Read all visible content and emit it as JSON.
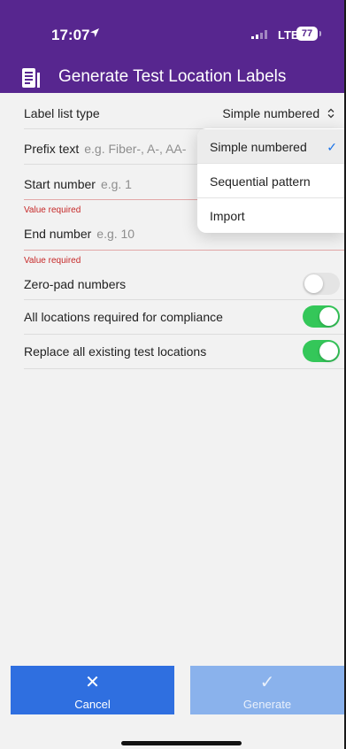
{
  "status_bar": {
    "time": "17:07",
    "network": "LTE",
    "battery": "77"
  },
  "header": {
    "title": "Generate Test Location Labels",
    "icon": "document-icon",
    "background": "#57268f"
  },
  "form": {
    "label_list_type": {
      "label": "Label list type",
      "value": "Simple numbered"
    },
    "prefix": {
      "label": "Prefix text",
      "placeholder": "e.g. Fiber-, A-, AA-"
    },
    "start_number": {
      "label": "Start number",
      "placeholder": "e.g. 1",
      "error": "Value required"
    },
    "end_number": {
      "label": "End number",
      "placeholder": "e.g. 10",
      "error": "Value required"
    },
    "zero_pad": {
      "label": "Zero-pad numbers",
      "on": false
    },
    "all_required": {
      "label": "All locations required for compliance",
      "on": true
    },
    "replace_all": {
      "label": "Replace all existing test locations",
      "on": true
    }
  },
  "dropdown": {
    "options": [
      "Simple numbered",
      "Sequential pattern",
      "Import"
    ],
    "selected": "Simple numbered"
  },
  "buttons": {
    "cancel": {
      "label": "Cancel",
      "icon": "close-icon"
    },
    "generate": {
      "label": "Generate",
      "icon": "checkmark-icon"
    }
  },
  "colors": {
    "accent": "#2f6fe0",
    "toggle_on": "#34c759",
    "error": "#c62828"
  }
}
